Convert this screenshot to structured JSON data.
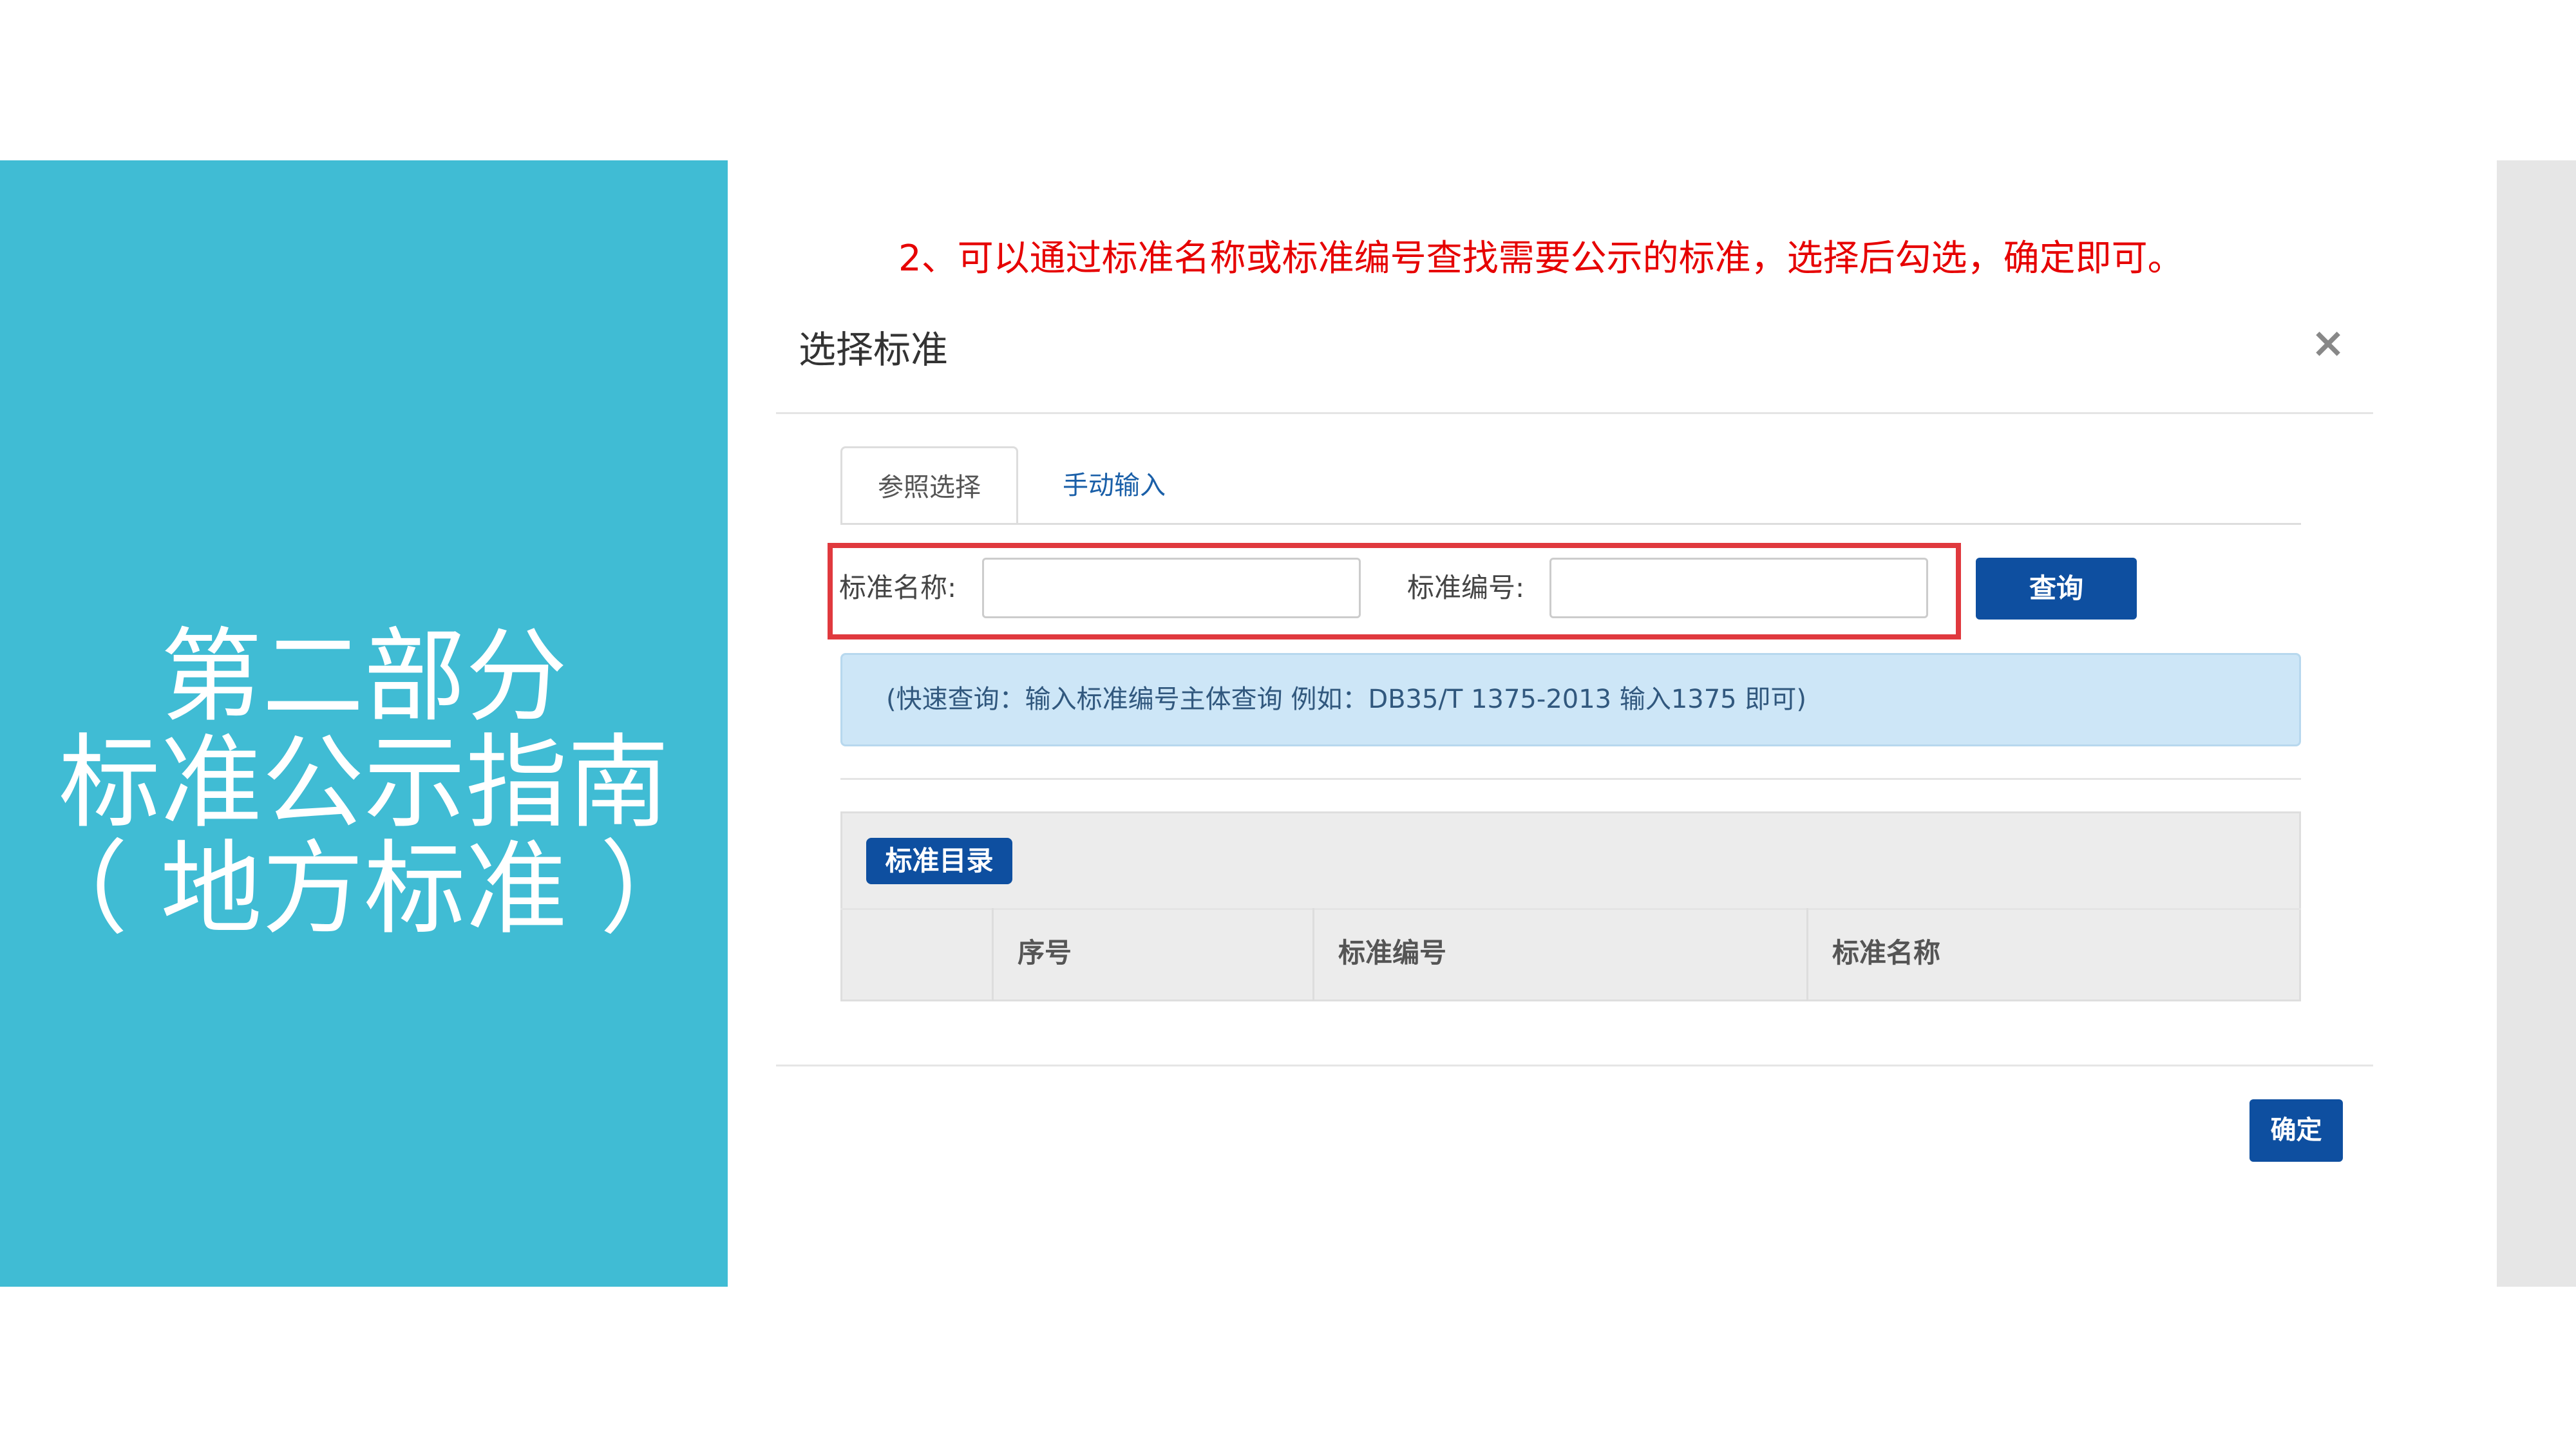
{
  "left_panel": {
    "title_lines": [
      "第二部分",
      "标准公示指南",
      "（ 地方标准 ）"
    ]
  },
  "instruction": "2、可以通过标准名称或标准编号查找需要公示的标准，选择后勾选，确定即可。",
  "dialog": {
    "title": "选择标准",
    "close_symbol": "×",
    "tabs": [
      {
        "label": "参照选择",
        "active": true
      },
      {
        "label": "手动输入",
        "active": false
      }
    ],
    "search": {
      "name_label": "标准名称:",
      "name_value": "",
      "code_label": "标准编号:",
      "code_value": "",
      "query_label": "查询"
    },
    "hint": "(快速查询：输入标准编号主体查询 例如：DB35/T 1375-2013 输入1375 即可)",
    "catalog": {
      "badge": "标准目录",
      "columns": [
        "",
        "序号",
        "标准编号",
        "标准名称"
      ]
    },
    "confirm_label": "确定"
  },
  "colors": {
    "left_panel_bg": "#40bcd4",
    "instruction_text": "#e60000",
    "highlight_border": "#e0393e",
    "primary_button": "#0e4fa0",
    "info_bg": "#cde6f7"
  }
}
